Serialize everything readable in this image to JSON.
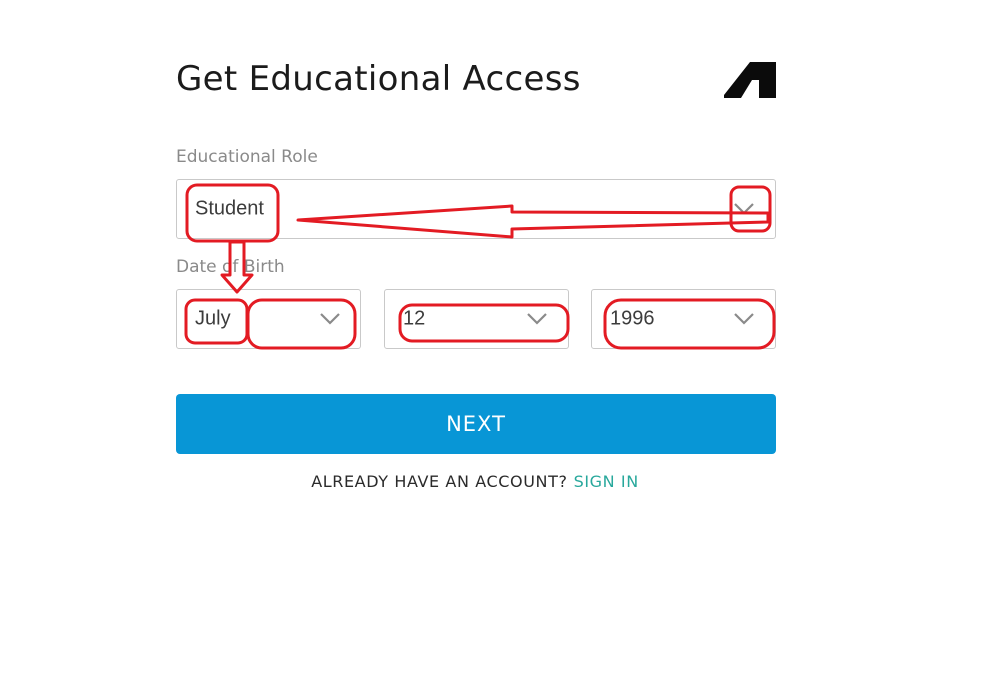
{
  "page": {
    "title": "Get Educational Access",
    "brand_logo": "autodesk-logo"
  },
  "form": {
    "role_label": "Educational Role",
    "role_value": "Student",
    "dob_label": "Date of Birth",
    "dob_month": "July",
    "dob_day": "12",
    "dob_year": "1996",
    "next_label": "NEXT"
  },
  "footer": {
    "question": "ALREADY HAVE AN ACCOUNT?",
    "signin_label": "SIGN IN"
  },
  "colors": {
    "primary_button": "#0896d6",
    "link": "#28a89c",
    "annotation": "#e31b23"
  }
}
